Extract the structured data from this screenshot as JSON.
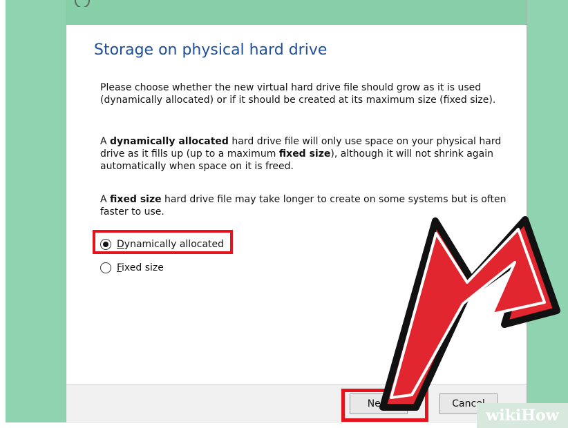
{
  "dialog": {
    "title": "Storage on physical hard drive",
    "paragraphs": {
      "p1": "Please choose whether the new virtual hard drive file should grow as it is used (dynamically allocated) or if it should be created at its maximum size (fixed size).",
      "p2_parts": {
        "a": "A ",
        "b": "dynamically allocated",
        "c": " hard drive file will only use space on your physical hard drive as it fills up (up to a maximum ",
        "d": "fixed size",
        "e": "), although it will not shrink again automatically when space on it is freed."
      },
      "p3_parts": {
        "a": "A ",
        "b": "fixed size",
        "c": " hard drive file may take longer to create on some systems but is often faster to use."
      }
    },
    "options": [
      {
        "mnemonic": "D",
        "rest": "ynamically allocated",
        "selected": true
      },
      {
        "mnemonic": "F",
        "rest": "ixed size",
        "selected": false
      }
    ],
    "buttons": {
      "next": "Next",
      "cancel": "Cancel"
    }
  },
  "watermark": {
    "wiki": "wiki",
    "how": "How"
  },
  "colors": {
    "background": "#8fd3b0",
    "highlight": "#e3141c",
    "title": "#1f4e9a"
  },
  "icons": [
    "radio-checked-icon",
    "radio-unchecked-icon",
    "pointer-arrow-icon"
  ]
}
